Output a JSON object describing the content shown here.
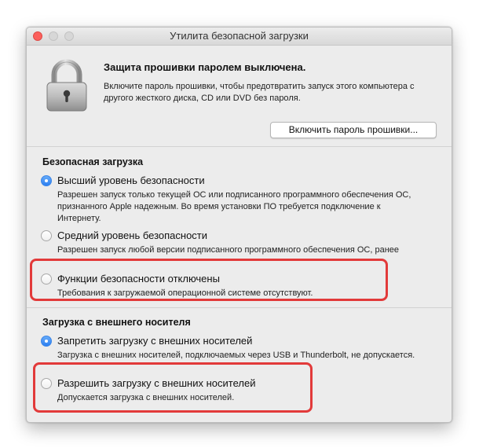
{
  "window": {
    "title": "Утилита безопасной загрузки"
  },
  "firmware": {
    "heading": "Защита прошивки паролем выключена.",
    "description": "Включите пароль прошивки, чтобы предотвратить запуск этого компьютера с другого жесткого диска, CD или DVD без пароля.",
    "button_label": "Включить пароль прошивки..."
  },
  "secure_boot": {
    "title": "Безопасная загрузка",
    "options": [
      {
        "label": "Высший уровень безопасности",
        "description": "Разрешен запуск только текущей ОС или подписанного программного обеспечения ОС, признанного Apple надежным. Во время установки ПО требуется подключение к Интернету.",
        "selected": true
      },
      {
        "label": "Средний уровень безопасности",
        "description": "Разрешен запуск любой версии подписанного программного обеспечения ОС, ранее признанного Apple надежным.",
        "selected": false
      },
      {
        "label": "Функции безопасности отключены",
        "description": "Требования к загружаемой операционной системе отсутствуют.",
        "selected": false
      }
    ]
  },
  "external_boot": {
    "title": "Загрузка с внешнего носителя",
    "options": [
      {
        "label": "Запретить загрузку с внешних носителей",
        "description": "Загрузка с внешних носителей, подключаемых через USB и Thunderbolt, не допускается.",
        "selected": true
      },
      {
        "label": "Разрешить загрузку с внешних носителей",
        "description": "Допускается загрузка с внешних носителей.",
        "selected": false
      }
    ]
  },
  "colors": {
    "highlight": "#e23a3a",
    "radio_selected": "#2c7ff2"
  }
}
